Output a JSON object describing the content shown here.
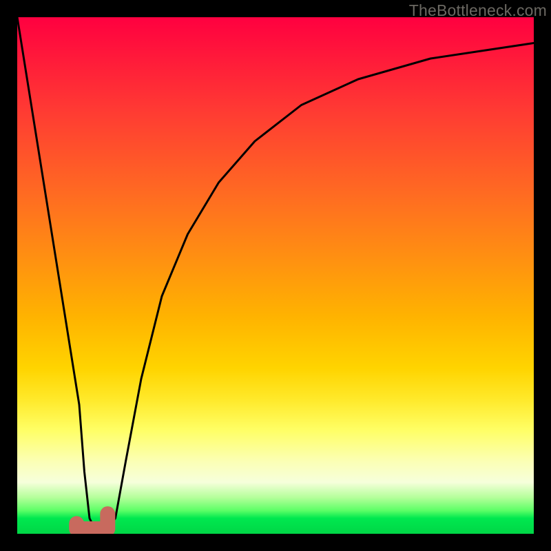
{
  "watermark": {
    "text": "TheBottleneck.com"
  },
  "chart_data": {
    "type": "line",
    "title": "",
    "xlabel": "",
    "ylabel": "",
    "xlim": [
      0,
      100
    ],
    "ylim": [
      0,
      100
    ],
    "grid": false,
    "series": [
      {
        "name": "curve",
        "x": [
          0,
          4,
          8,
          12,
          13,
          14,
          15,
          16,
          17.5,
          19,
          21,
          24,
          28,
          33,
          39,
          46,
          55,
          66,
          80,
          100
        ],
        "y": [
          100,
          75,
          50,
          25,
          12,
          3,
          1,
          1,
          1,
          3,
          14,
          30,
          46,
          58,
          68,
          76,
          83,
          88,
          92,
          95
        ]
      }
    ],
    "marker": {
      "cx_pct": 14.5,
      "cy_pct": 97.6,
      "width_pct": 6.0,
      "height_pct": 2.9,
      "radius_px": 11,
      "color": "#c86a5e"
    },
    "background": {
      "type": "vertical-gradient",
      "stops": [
        {
          "pos": 0.0,
          "color": "#ff0040"
        },
        {
          "pos": 0.5,
          "color": "#ff9a10"
        },
        {
          "pos": 0.8,
          "color": "#ffff66"
        },
        {
          "pos": 0.95,
          "color": "#5cff66"
        },
        {
          "pos": 1.0,
          "color": "#00d646"
        }
      ]
    }
  }
}
